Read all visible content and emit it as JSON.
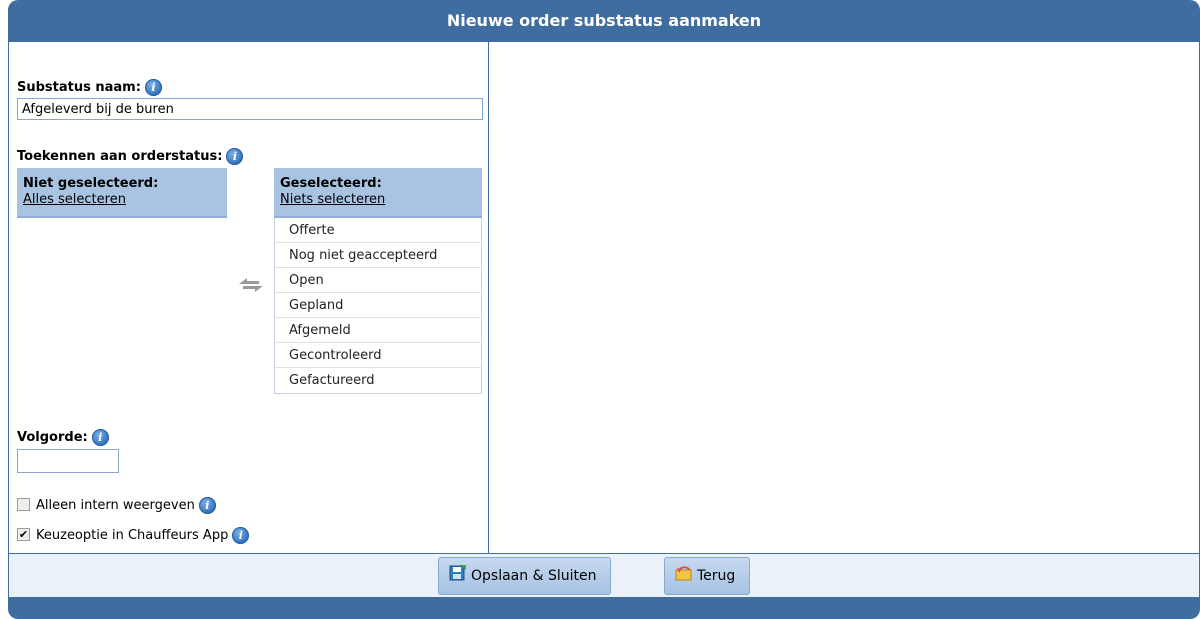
{
  "window": {
    "title": "Nieuwe order substatus aanmaken"
  },
  "substatus": {
    "label": "Substatus naam:",
    "value": "Afgeleverd bij de buren"
  },
  "orderstatus": {
    "label": "Toekennen aan orderstatus:",
    "not_selected": {
      "header": "Niet geselecteerd:",
      "link": "Alles selecteren"
    },
    "selected": {
      "header": "Geselecteerd:",
      "link": "Niets selecteren",
      "items": [
        "Offerte",
        "Nog niet geaccepteerd",
        "Open",
        "Gepland",
        "Afgemeld",
        "Gecontroleerd",
        "Gefactureerd"
      ]
    }
  },
  "volgorde": {
    "label": "Volgorde:",
    "value": ""
  },
  "options": {
    "intern": {
      "label": "Alleen intern weergeven",
      "checked": false
    },
    "chauffeurs_app": {
      "label": "Keuzeoptie in Chauffeurs App",
      "checked": true
    }
  },
  "footer": {
    "save_label": "Opslaan & Sluiten",
    "back_label": "Terug"
  },
  "colors": {
    "header": "#3f6d9f",
    "box_head": "#a9c4e2",
    "footer_bg": "#eaf1f9"
  },
  "icons": {
    "info": "info-icon",
    "swap": "swap-arrows-icon",
    "save": "save-icon",
    "back": "back-icon"
  }
}
